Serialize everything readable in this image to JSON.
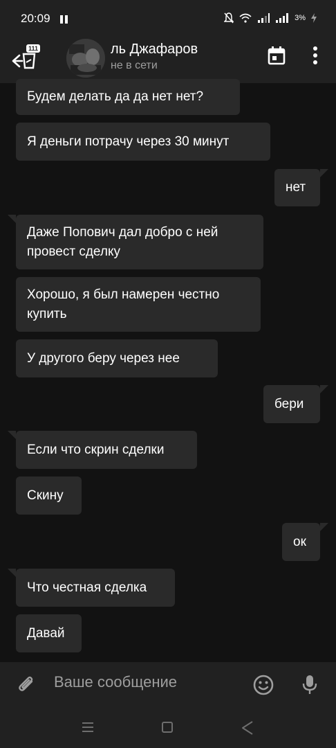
{
  "status_bar": {
    "time": "20:09",
    "battery": "3%"
  },
  "header": {
    "badge": "111",
    "title": "ль Джафаров",
    "subtitle": "не в сети"
  },
  "messages": [
    {
      "text": "Будем делать да да нет нет?",
      "direction": "in"
    },
    {
      "text": "Я деньги потрачу через 30 минут",
      "direction": "in"
    },
    {
      "text": "нет",
      "direction": "out"
    },
    {
      "text": "Даже Попович дал добро с ней\nпровест  сделку",
      "direction": "in"
    },
    {
      "text": "Хорошо, я был намерен честно\nкупить",
      "direction": "in"
    },
    {
      "text": "У другого беру через нее",
      "direction": "in"
    },
    {
      "text": "бери",
      "direction": "out"
    },
    {
      "text": "Если что скрин сделки",
      "direction": "in"
    },
    {
      "text": "Скину",
      "direction": "in"
    },
    {
      "text": "ок",
      "direction": "out"
    },
    {
      "text": "Что честная сделка",
      "direction": "in"
    },
    {
      "text": "Давай",
      "direction": "in"
    }
  ],
  "input": {
    "placeholder": "Ваше сообщение"
  },
  "colors": {
    "background": "#121212",
    "bar": "#212121",
    "bubble": "#2a2a2a",
    "muted_text": "#9e9e9e"
  },
  "icons": [
    "back-arrow-icon",
    "calendar-icon",
    "more-vert-icon",
    "attach-icon",
    "emoji-icon",
    "mic-icon"
  ]
}
